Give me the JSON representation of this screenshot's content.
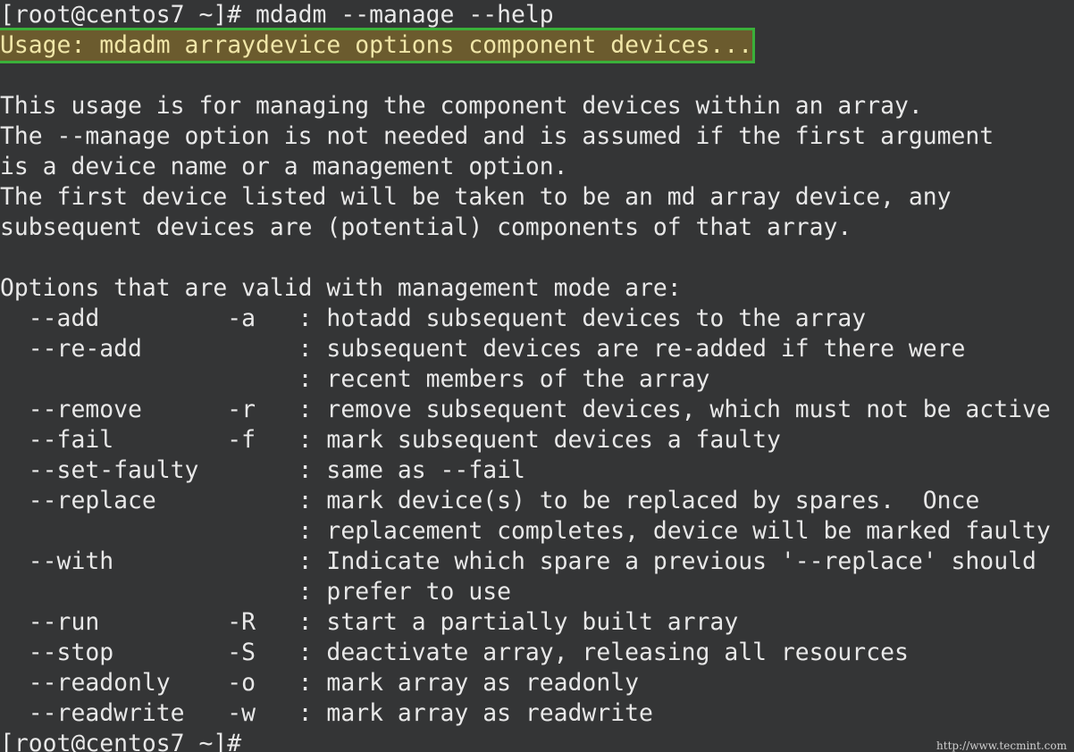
{
  "terminal": {
    "lines": [
      "[root@centos7 ~]# mdadm --manage --help",
      "Usage: mdadm arraydevice options component devices...",
      "",
      "This usage is for managing the component devices within an array.",
      "The --manage option is not needed and is assumed if the first argument",
      "is a device name or a management option.",
      "The first device listed will be taken to be an md array device, any",
      "subsequent devices are (potential) components of that array.",
      "",
      "Options that are valid with management mode are:",
      "  --add         -a   : hotadd subsequent devices to the array",
      "  --re-add           : subsequent devices are re-added if there were",
      "                     : recent members of the array",
      "  --remove      -r   : remove subsequent devices, which must not be active",
      "  --fail        -f   : mark subsequent devices a faulty",
      "  --set-faulty       : same as --fail",
      "  --replace          : mark device(s) to be replaced by spares.  Once",
      "                     : replacement completes, device will be marked faulty",
      "  --with             : Indicate which spare a previous '--replace' should",
      "                     : prefer to use",
      "  --run         -R   : start a partially built array",
      "  --stop        -S   : deactivate array, releasing all resources",
      "  --readonly    -o   : mark array as readonly",
      "  --readwrite   -w   : mark array as readwrite",
      "[root@centos7 ~]#"
    ],
    "highlighted_line_index": 1,
    "highlight_color": "#3ab03a"
  },
  "watermark": "http://www.tecmint.com"
}
